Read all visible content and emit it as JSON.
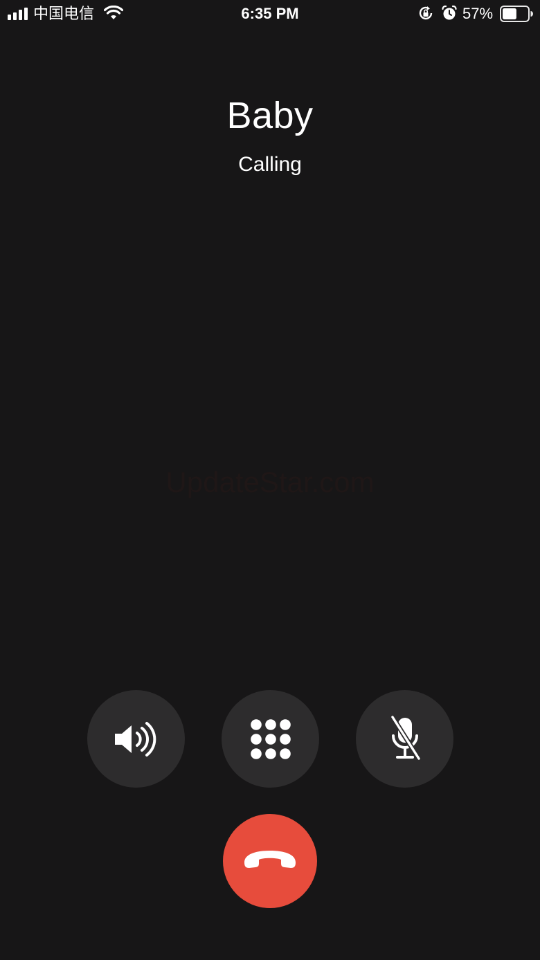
{
  "status_bar": {
    "carrier": "中国电信",
    "time": "6:35 PM",
    "battery_percent": "57%",
    "battery_level": 0.57,
    "icons": [
      "signal-icon",
      "wifi-icon",
      "rotation-lock-icon",
      "alarm-icon",
      "battery-icon"
    ]
  },
  "call": {
    "caller_name": "Baby",
    "status": "Calling"
  },
  "watermark": "UpdateStar.com",
  "controls": {
    "buttons": [
      {
        "name": "speaker-button",
        "icon": "speaker-icon"
      },
      {
        "name": "keypad-button",
        "icon": "keypad-icon"
      },
      {
        "name": "mute-button",
        "icon": "microphone-muted-icon"
      }
    ],
    "end_call": {
      "name": "end-call-button",
      "icon": "phone-hangup-icon",
      "color": "#e74c3c"
    }
  },
  "colors": {
    "background": "#171617",
    "control_button": "#2d2c2d",
    "end_call": "#e74c3c",
    "text": "#ffffff"
  }
}
